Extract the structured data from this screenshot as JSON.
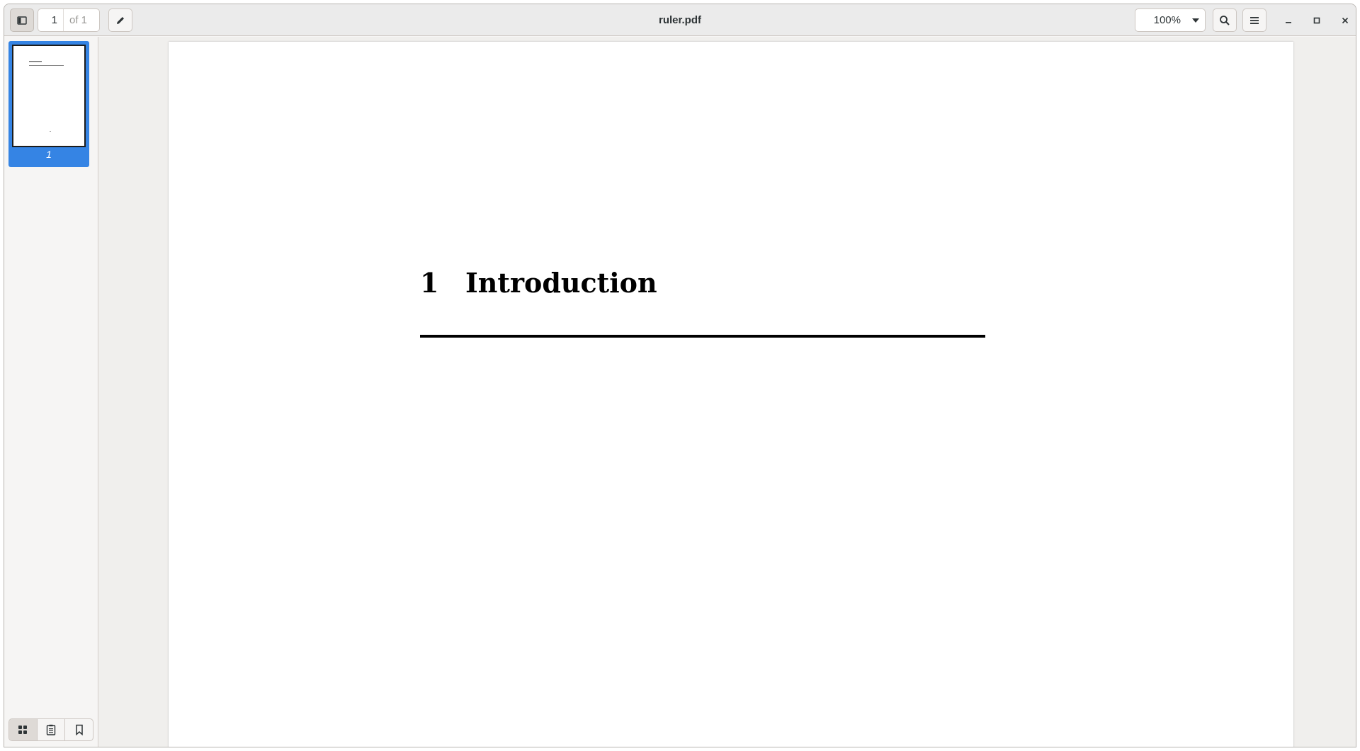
{
  "window": {
    "title": "ruler.pdf"
  },
  "toolbar": {
    "page_current": "1",
    "page_total": "of 1",
    "zoom_value": "100%"
  },
  "sidebar": {
    "thumbnails": [
      {
        "label": "1",
        "selected": true
      }
    ],
    "modes": [
      "thumbnails",
      "outline",
      "bookmarks"
    ],
    "active_mode": "thumbnails"
  },
  "document": {
    "section_number": "1",
    "section_title": "Introduction"
  },
  "colors": {
    "accent": "#3584e4",
    "headerbar": "#ebebeb",
    "page": "#ffffff"
  }
}
